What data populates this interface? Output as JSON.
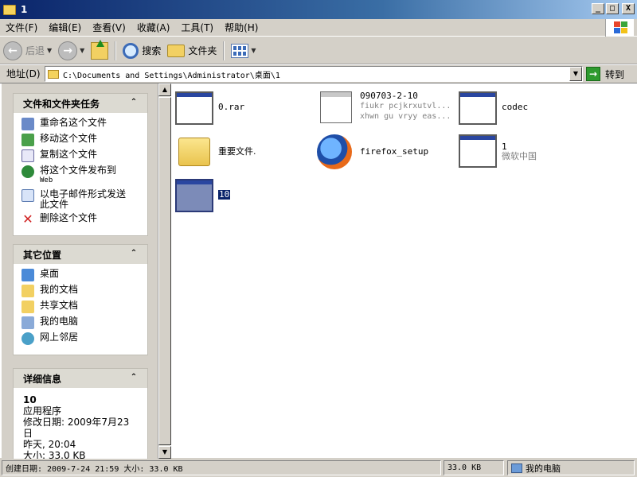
{
  "window": {
    "title": "1",
    "controls": {
      "minimize": "_",
      "maximize": "□",
      "close": "X"
    }
  },
  "menu": [
    "文件(F)",
    "编辑(E)",
    "查看(V)",
    "收藏(A)",
    "工具(T)",
    "帮助(H)"
  ],
  "toolbar": {
    "back": "后退",
    "search": "搜索",
    "folders": "文件夹"
  },
  "address": {
    "label": "地址(D)",
    "value": "C:\\Documents and Settings\\Administrator\\桌面\\1",
    "go": "转到"
  },
  "tasks": {
    "title": "文件和文件夹任务",
    "items": [
      {
        "label": "重命名这个文件"
      },
      {
        "label": "移动这个文件"
      },
      {
        "label": "复制这个文件"
      },
      {
        "label": "将这个文件发布到",
        "sub": "Web"
      },
      {
        "label": "以电子邮件形式发送",
        "label2": "此文件"
      },
      {
        "label": "删除这个文件"
      }
    ]
  },
  "places": {
    "title": "其它位置",
    "items": [
      "桌面",
      "我的文档",
      "共享文档",
      "我的电脑",
      "网上邻居"
    ]
  },
  "details": {
    "title": "详细信息",
    "name": "10",
    "type": "应用程序",
    "modified_label": "修改日期: 2009年7月23日",
    "modified_time": "昨天, 20:04",
    "size": "大小: 33.0 KB"
  },
  "files": [
    {
      "name": "0.rar"
    },
    {
      "name": "090703-2-10",
      "sub1": "fiukr pcjkrxutvl...",
      "sub2": "xhwn gu vryy eas..."
    },
    {
      "name": "codec"
    },
    {
      "name": "重要文件."
    },
    {
      "name": "firefox_setup"
    },
    {
      "name": "1",
      "sub1": "微软中国"
    },
    {
      "name": "10"
    }
  ],
  "status": {
    "main": "创建日期: 2009-7-24 21:59 大小: 33.0 KB",
    "size": "33.0 KB",
    "location": "我的电脑"
  },
  "colors": {
    "titlebar": "#0a246a",
    "selection": "#0a246a",
    "taskpane": "#d4d0c8"
  }
}
